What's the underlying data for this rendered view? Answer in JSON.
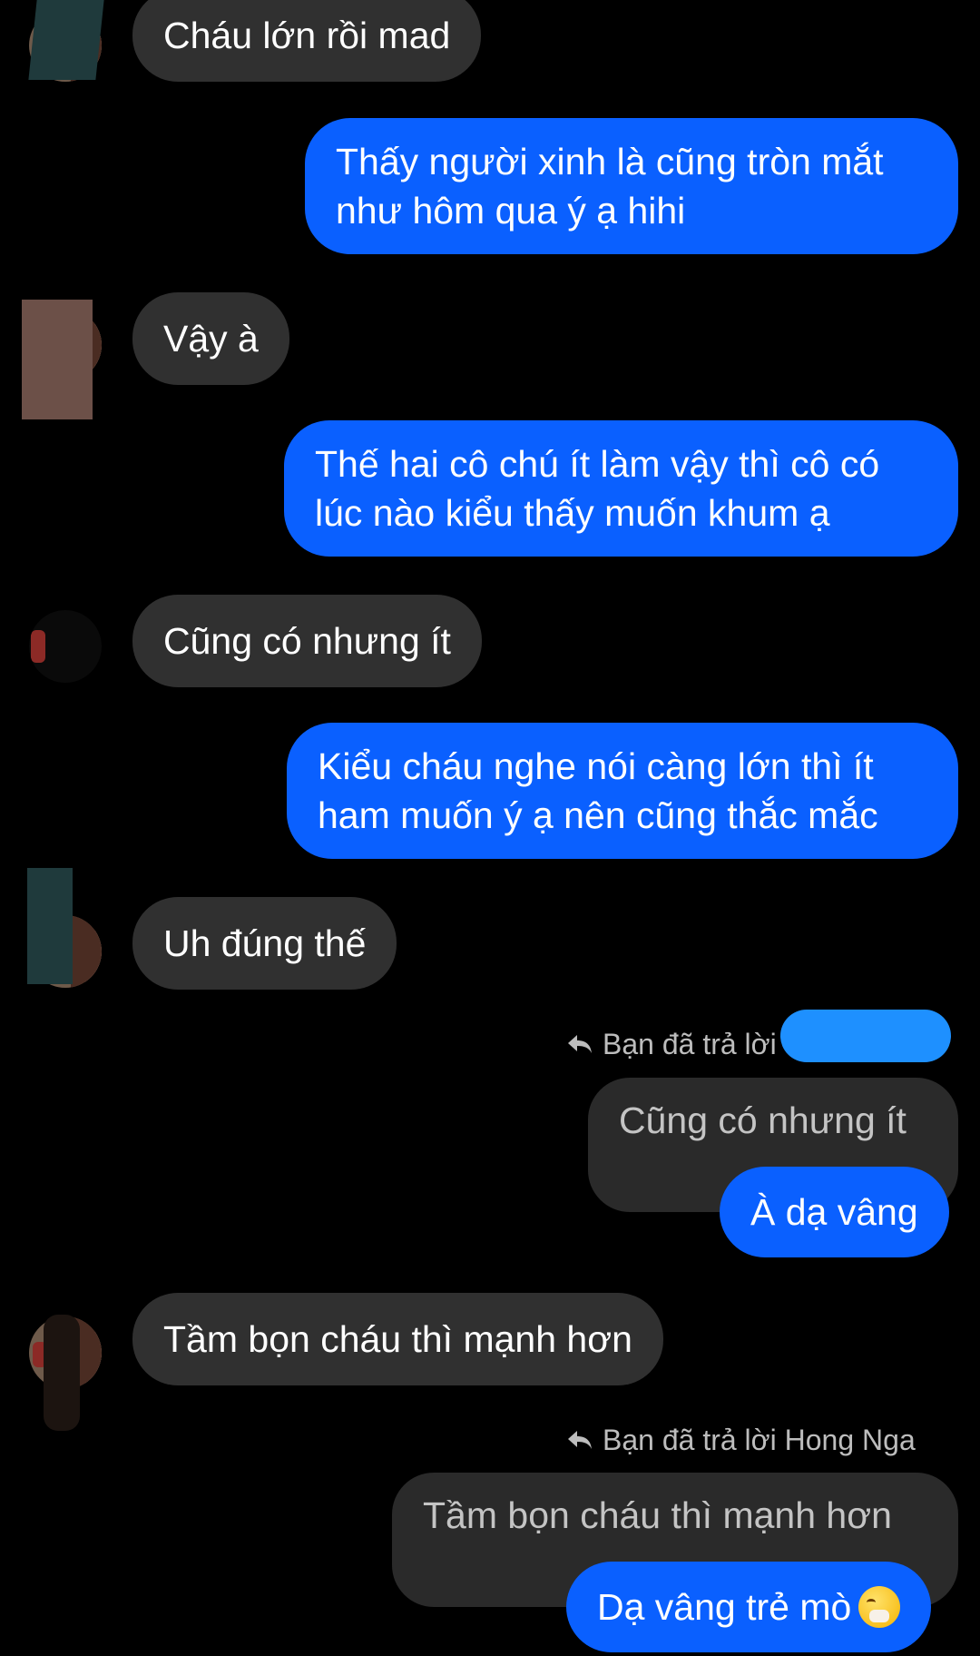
{
  "messages": {
    "m1": "Cháu lớn rồi mad",
    "m2_line1": "Thấy người xinh là cũng tròn mắt",
    "m2_line2": "như hôm qua ý ạ hihi",
    "m3": "Vậy à",
    "m4_line1": "Thế hai cô chú ít làm vậy thì cô có",
    "m4_line2": "lúc nào kiểu thấy muốn khum ạ",
    "m5": "Cũng có nhưng ít",
    "m6_line1": "Kiểu cháu nghe nói càng lớn thì ít",
    "m6_line2": "ham muốn ý ạ nên cũng thắc mắc",
    "m7": "Uh đúng thế",
    "reply1_meta": "Bạn đã trả lời",
    "reply1_quote": "Cũng có nhưng ít",
    "m8": "À dạ vâng",
    "m9": "Tầm bọn cháu thì mạnh hơn",
    "reply2_meta": "Bạn đã trả lời Hong Nga",
    "reply2_quote": "Tầm bọn cháu thì mạnh hơn",
    "m10": "Dạ vâng trẻ mò"
  },
  "icons": {
    "reply": "reply-arrow-icon",
    "emoji": "face-with-hand-over-mouth-emoji"
  },
  "colors": {
    "background": "#000000",
    "incoming_bubble": "#303030",
    "outgoing_bubble": "#0a60ff",
    "quoted_bubble": "#2a2a2a",
    "redaction": "#1e90ff"
  }
}
